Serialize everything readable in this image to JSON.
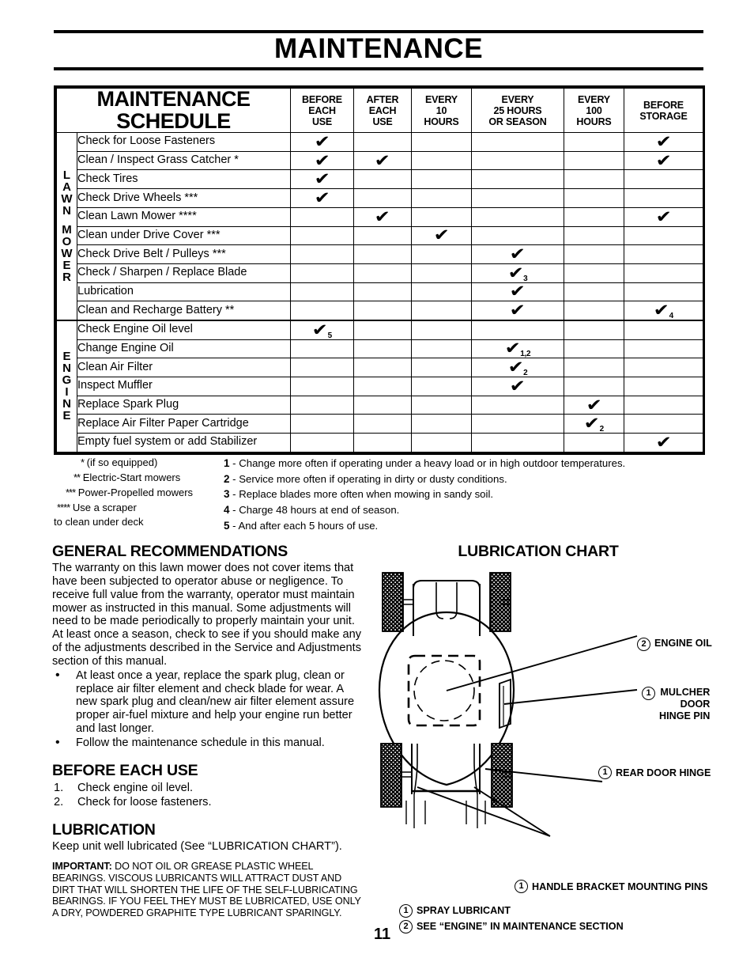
{
  "page": {
    "title": "MAINTENANCE",
    "number": "11"
  },
  "schedule": {
    "title_line1": "MAINTENANCE",
    "title_line2": "SCHEDULE",
    "columns": [
      "BEFORE\nEACH\nUSE",
      "AFTER\nEACH\nUSE",
      "EVERY\n10\nHOURS",
      "EVERY\n25 HOURS\nOR SEASON",
      "EVERY\n100\nHOURS",
      "BEFORE\nSTORAGE"
    ],
    "groups": [
      {
        "label_lines": [
          "L",
          "A",
          "W",
          "N",
          "",
          "M",
          "O",
          "W",
          "E",
          "R"
        ],
        "label_text": "LAWN MOWER",
        "rows": [
          {
            "task": "Check for Loose Fasteners",
            "marks": [
              "check",
              "",
              "",
              "",
              "",
              "check"
            ]
          },
          {
            "task": "Clean / Inspect Grass Catcher *",
            "marks": [
              "check",
              "check",
              "",
              "",
              "",
              "check"
            ]
          },
          {
            "task": "Check Tires",
            "marks": [
              "check",
              "",
              "",
              "",
              "",
              ""
            ]
          },
          {
            "task": "Check Drive Wheels ***",
            "marks": [
              "check",
              "",
              "",
              "",
              "",
              ""
            ]
          },
          {
            "task": "Clean Lawn Mower ****",
            "marks": [
              "",
              "check",
              "",
              "",
              "",
              "check"
            ]
          },
          {
            "task": "Clean under Drive Cover ***",
            "marks": [
              "",
              "",
              "check",
              "",
              "",
              ""
            ]
          },
          {
            "task": "Check Drive Belt / Pulleys ***",
            "marks": [
              "",
              "",
              "",
              "check",
              "",
              ""
            ]
          },
          {
            "task": "Check / Sharpen / Replace Blade",
            "marks": [
              "",
              "",
              "",
              "check:3",
              "",
              ""
            ]
          },
          {
            "task": "Lubrication",
            "marks": [
              "",
              "",
              "",
              "check",
              "",
              ""
            ]
          },
          {
            "task": "Clean and Recharge Battery **",
            "marks": [
              "",
              "",
              "",
              "check",
              "",
              "check:4"
            ]
          }
        ]
      },
      {
        "label_lines": [
          "E",
          "N",
          "G",
          "I",
          "N",
          "E"
        ],
        "label_text": "ENGINE",
        "rows": [
          {
            "task": "Check Engine Oil level",
            "marks": [
              "check:5",
              "",
              "",
              "",
              "",
              ""
            ]
          },
          {
            "task": "Change Engine Oil",
            "marks": [
              "",
              "",
              "",
              "check:1,2",
              "",
              ""
            ]
          },
          {
            "task": "Clean Air Filter",
            "marks": [
              "",
              "",
              "",
              "check:2",
              "",
              ""
            ]
          },
          {
            "task": "Inspect Muffler",
            "marks": [
              "",
              "",
              "",
              "check",
              "",
              ""
            ]
          },
          {
            "task": "Replace Spark Plug",
            "marks": [
              "",
              "",
              "",
              "",
              "check",
              ""
            ]
          },
          {
            "task": "Replace Air Filter Paper Cartridge",
            "marks": [
              "",
              "",
              "",
              "",
              "check:2",
              ""
            ]
          },
          {
            "task": "Empty fuel system or add Stabilizer",
            "marks": [
              "",
              "",
              "",
              "",
              "",
              "check"
            ]
          }
        ]
      }
    ],
    "star_notes": [
      {
        "stars": "*",
        "text": "(if so equipped)"
      },
      {
        "stars": "**",
        "text": "Electric-Start mowers"
      },
      {
        "stars": "***",
        "text": "Power-Propelled mowers"
      },
      {
        "stars": "****",
        "text": "Use a scraper"
      },
      {
        "stars": "",
        "text": "to clean under deck"
      }
    ],
    "numbered_notes": [
      {
        "n": "1",
        "text": "- Change more often if operating under a heavy load or in high outdoor temperatures."
      },
      {
        "n": "2",
        "text": "- Service more often if operating in dirty or dusty conditions."
      },
      {
        "n": "3",
        "text": "- Replace blades more often when mowing in sandy soil."
      },
      {
        "n": "4",
        "text": "- Charge 48 hours at end of season."
      },
      {
        "n": "5",
        "text": "- And after each 5 hours of use."
      }
    ]
  },
  "general": {
    "heading": "GENERAL RECOMMENDATIONS",
    "paragraph": "The warranty on this lawn mower does not cover items that have been subjected to operator abuse or negligence.  To receive full value from the warranty, operator must maintain mower as instructed in this manual. Some adjustments will need to be made periodically to properly maintain your unit.  At least once a season, check to see if you should make any of the adjustments described in the Service and Adjustments section of this manual.",
    "bullets": [
      "At least once a year, replace the spark plug, clean or replace air filter element and check blade for wear. A new spark plug and clean/new air filter element assure proper air-fuel mixture and help your engine run better and last longer.",
      "Follow the maintenance schedule in this manual."
    ]
  },
  "before_each_use": {
    "heading": "BEFORE EACH USE",
    "items": [
      {
        "n": "1.",
        "text": "Check engine oil level."
      },
      {
        "n": "2.",
        "text": "Check for loose fasteners."
      }
    ]
  },
  "lubrication": {
    "heading": "LUBRICATION",
    "intro": "Keep unit well lubricated (See “LUBRICATION CHART”).",
    "important_label": "IMPORTANT:",
    "important_text": "DO NOT OIL OR GREASE PLASTIC WHEEL BEARINGS.  VISCOUS LUBRICANTS WILL ATTRACT DUST AND DIRT THAT WILL SHORTEN THE LIFE OF THE SELF-LUBRICATING BEARINGS.  IF YOU FEEL THEY MUST BE LUBRICATED, USE ONLY A DRY, POWDERED GRAPHITE TYPE LUBRICANT SPARINGLY."
  },
  "lube_chart": {
    "heading": "LUBRICATION CHART",
    "callouts": [
      {
        "num": "2",
        "lines": [
          "ENGINE OIL"
        ]
      },
      {
        "num": "1",
        "lines": [
          "MULCHER",
          "DOOR",
          "HINGE PIN"
        ]
      },
      {
        "num": "1",
        "lines": [
          "REAR DOOR HINGE"
        ]
      },
      {
        "num": "1",
        "lines": [
          "HANDLE BRACKET MOUNTING PINS"
        ]
      }
    ],
    "legend": [
      {
        "num": "1",
        "text": "SPRAY LUBRICANT"
      },
      {
        "num": "2",
        "text": "SEE “ENGINE” IN MAINTENANCE SECTION"
      }
    ]
  }
}
